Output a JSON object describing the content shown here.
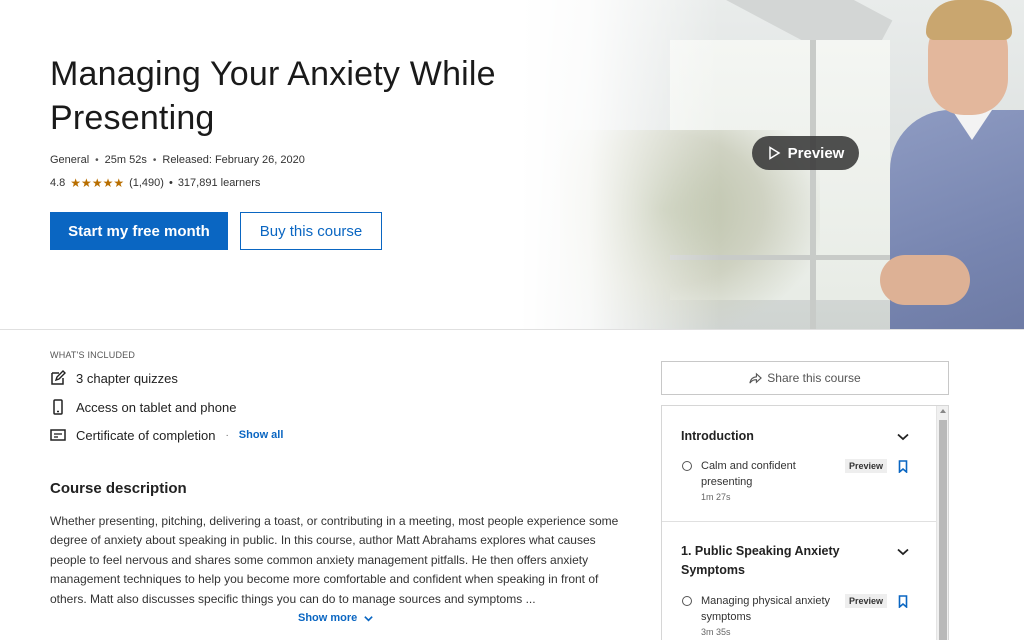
{
  "course": {
    "title": "Managing Your Anxiety While Presenting",
    "level": "General",
    "duration": "25m 52s",
    "released": "Released: February 26, 2020",
    "rating_value": "4.8",
    "rating_count": "(1,490)",
    "learners": "317,891 learners",
    "stars": "★★★★★"
  },
  "hero": {
    "preview_label": "Preview",
    "primary_cta": "Start my free month",
    "secondary_cta": "Buy this course"
  },
  "included": {
    "label": "WHAT'S INCLUDED",
    "items": [
      {
        "label": "3 chapter quizzes",
        "icon": "edit-icon"
      },
      {
        "label": "Access on tablet and phone",
        "icon": "mobile-icon"
      },
      {
        "label": "Certificate of completion",
        "icon": "certificate-icon"
      }
    ],
    "show_all": "Show all"
  },
  "description": {
    "heading": "Course description",
    "text": "Whether presenting, pitching, delivering a toast, or contributing in a meeting, most people experience some degree of anxiety about speaking in public. In this course, author Matt Abrahams explores what causes people to feel nervous and shares some common anxiety management pitfalls. He then offers anxiety management techniques to help you become more comfortable and confident when speaking in front of others. Matt also discusses specific things you can do to manage sources and symptoms ...",
    "show_more": "Show more"
  },
  "sidebar": {
    "share_label": "Share this course",
    "chapters": [
      {
        "title": "Introduction",
        "lessons": [
          {
            "title": "Calm and confident presenting",
            "duration": "1m 27s",
            "badge": "Preview"
          }
        ]
      },
      {
        "title": "1. Public Speaking Anxiety Symptoms",
        "lessons": [
          {
            "title": "Managing physical anxiety symptoms",
            "duration": "3m 35s",
            "badge": "Preview"
          }
        ]
      }
    ]
  },
  "colors": {
    "accent": "#0a66c2",
    "star": "#b86e00"
  }
}
